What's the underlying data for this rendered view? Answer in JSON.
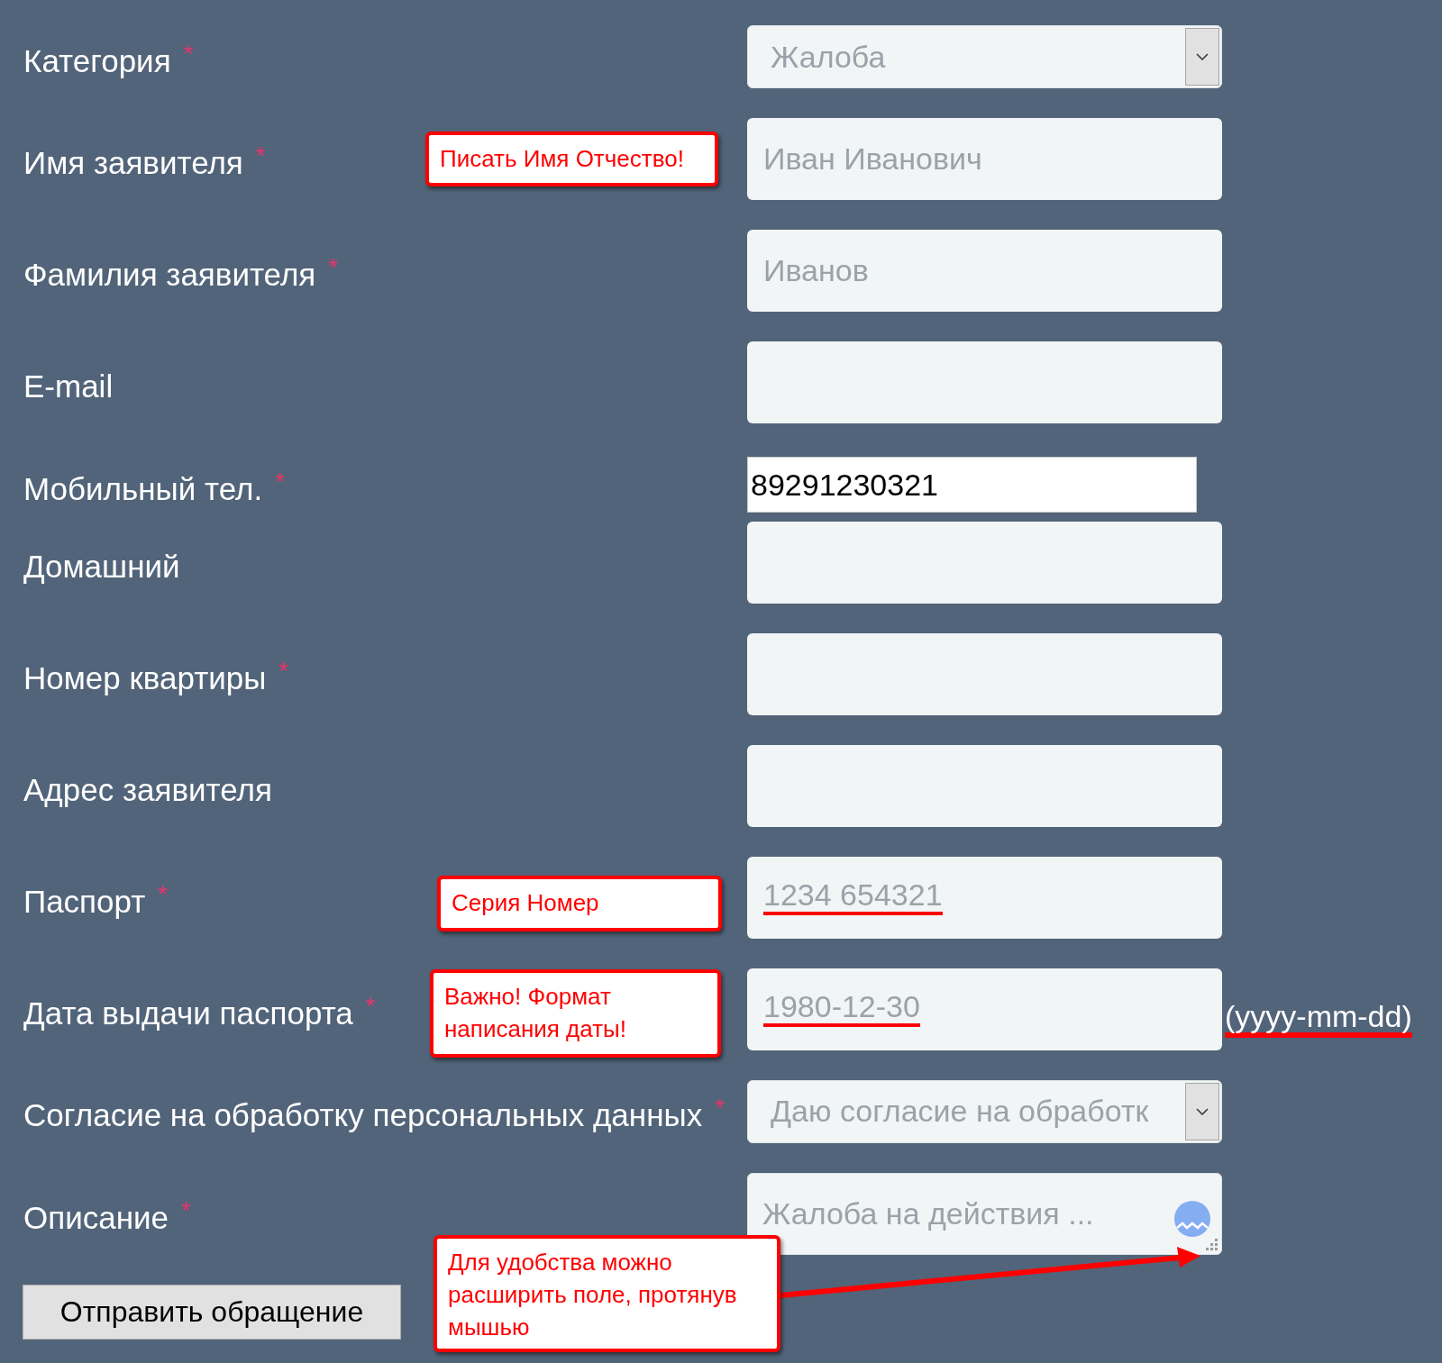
{
  "required_mark": "*",
  "fields": [
    {
      "kind": "select",
      "label": "Категория",
      "required": true,
      "value": "Жалоба"
    },
    {
      "kind": "input",
      "label": "Имя заявителя",
      "required": true,
      "placeholder": "Иван Иванович",
      "callout": "Писать Имя Отчество!"
    },
    {
      "kind": "input",
      "label": "Фамилия заявителя",
      "required": true,
      "placeholder": "Иванов"
    },
    {
      "kind": "input",
      "label": "E-mail",
      "required": false
    },
    {
      "kind": "phone",
      "label": "Мобильный тел.",
      "required": true,
      "value": "89291230321"
    },
    {
      "kind": "input",
      "label": "Домашний",
      "required": false
    },
    {
      "kind": "input",
      "label": "Номер квартиры",
      "required": true
    },
    {
      "kind": "input",
      "label": "Адрес заявителя",
      "required": false
    },
    {
      "kind": "input",
      "label": "Паспорт",
      "required": true,
      "placeholder": "1234 654321",
      "underlined": true,
      "callout": "Серия Номер"
    },
    {
      "kind": "input",
      "label": "Дата выдачи паспорта",
      "required": true,
      "placeholder": "1980-12-30",
      "underlined": true,
      "callout": "Важно! Формат написания даты!",
      "suffix": "(yyyy-mm-dd)",
      "suffix_underlined": true
    },
    {
      "kind": "select",
      "label": "Согласие на обработку персональных данных",
      "required": true,
      "value": "Даю согласие на обработк"
    },
    {
      "kind": "textarea",
      "label": "Описание",
      "required": true,
      "placeholder": "Жалоба на действия ...",
      "callout": "Для удобства можно расширить поле, протянув мышью"
    }
  ],
  "submit": "Отправить обращение"
}
